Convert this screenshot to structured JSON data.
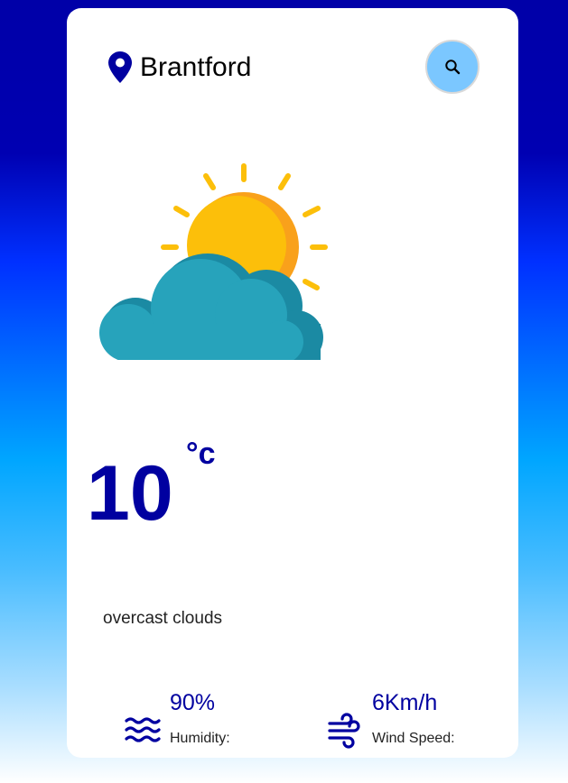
{
  "location": {
    "city": "Brantford",
    "icon": "map-pin-icon"
  },
  "search": {
    "icon": "search-icon",
    "label": "Search"
  },
  "weather": {
    "icon": "sun-behind-cloud-icon",
    "temperature": "10",
    "unit": "°c",
    "description": "overcast clouds"
  },
  "humidity": {
    "value": "90%",
    "label": "Humidity:",
    "icon": "water-waves-icon"
  },
  "wind": {
    "value": "6Km/h",
    "label": "Wind Speed:",
    "icon": "wind-icon"
  },
  "colors": {
    "accent": "#0000a0",
    "search_button": "#7bc7ff",
    "sun": "#fcbf0a",
    "sun_shade": "#f9a11b",
    "cloud": "#27a3bb",
    "cloud_shade": "#1b8aa3"
  }
}
